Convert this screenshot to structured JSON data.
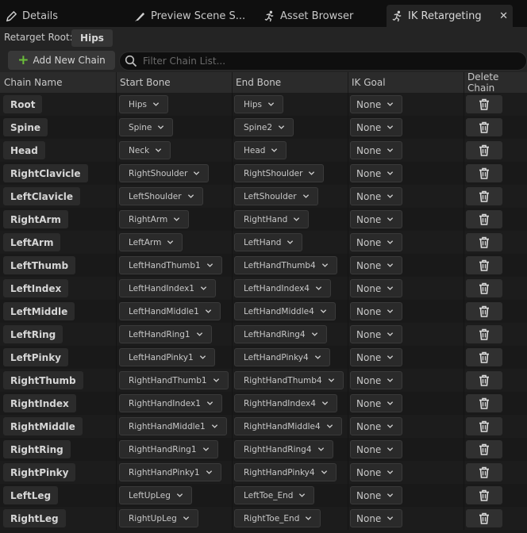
{
  "tabs": [
    {
      "label": "Details",
      "icon": "pencil-icon"
    },
    {
      "label": "Preview Scene S...",
      "icon": "brush-icon"
    },
    {
      "label": "Asset Browser",
      "icon": "running-figure-icon"
    },
    {
      "label": "IK Retargeting",
      "icon": "running-figure-icon",
      "active": true
    }
  ],
  "retarget_root": {
    "label": "Retarget Root:",
    "value": "Hips"
  },
  "toolbar": {
    "add_label": "Add New Chain",
    "search_placeholder": "Filter Chain List..."
  },
  "columns": [
    "Chain Name",
    "Start Bone",
    "End Bone",
    "IK Goal",
    "Delete Chain"
  ],
  "chains": [
    {
      "name": "Root",
      "start": "Hips",
      "end": "Hips",
      "goal": "None"
    },
    {
      "name": "Spine",
      "start": "Spine",
      "end": "Spine2",
      "goal": "None"
    },
    {
      "name": "Head",
      "start": "Neck",
      "end": "Head",
      "goal": "None"
    },
    {
      "name": "RightClavicle",
      "start": "RightShoulder",
      "end": "RightShoulder",
      "goal": "None"
    },
    {
      "name": "LeftClavicle",
      "start": "LeftShoulder",
      "end": "LeftShoulder",
      "goal": "None"
    },
    {
      "name": "RightArm",
      "start": "RightArm",
      "end": "RightHand",
      "goal": "None"
    },
    {
      "name": "LeftArm",
      "start": "LeftArm",
      "end": "LeftHand",
      "goal": "None"
    },
    {
      "name": "LeftThumb",
      "start": "LeftHandThumb1",
      "end": "LeftHandThumb4",
      "goal": "None"
    },
    {
      "name": "LeftIndex",
      "start": "LeftHandIndex1",
      "end": "LeftHandIndex4",
      "goal": "None"
    },
    {
      "name": "LeftMiddle",
      "start": "LeftHandMiddle1",
      "end": "LeftHandMiddle4",
      "goal": "None"
    },
    {
      "name": "LeftRing",
      "start": "LeftHandRing1",
      "end": "LeftHandRing4",
      "goal": "None"
    },
    {
      "name": "LeftPinky",
      "start": "LeftHandPinky1",
      "end": "LeftHandPinky4",
      "goal": "None"
    },
    {
      "name": "RightThumb",
      "start": "RightHandThumb1",
      "end": "RightHandThumb4",
      "goal": "None"
    },
    {
      "name": "RightIndex",
      "start": "RightHandIndex1",
      "end": "RightHandIndex4",
      "goal": "None"
    },
    {
      "name": "RightMiddle",
      "start": "RightHandMiddle1",
      "end": "RightHandMiddle4",
      "goal": "None"
    },
    {
      "name": "RightRing",
      "start": "RightHandRing1",
      "end": "RightHandRing4",
      "goal": "None"
    },
    {
      "name": "RightPinky",
      "start": "RightHandPinky1",
      "end": "RightHandPinky4",
      "goal": "None"
    },
    {
      "name": "LeftLeg",
      "start": "LeftUpLeg",
      "end": "LeftToe_End",
      "goal": "None"
    },
    {
      "name": "RightLeg",
      "start": "RightUpLeg",
      "end": "RightToe_End",
      "goal": "None"
    }
  ],
  "colors": {
    "accent_add": "#6bbf3a",
    "background": "#1a1a1a"
  }
}
